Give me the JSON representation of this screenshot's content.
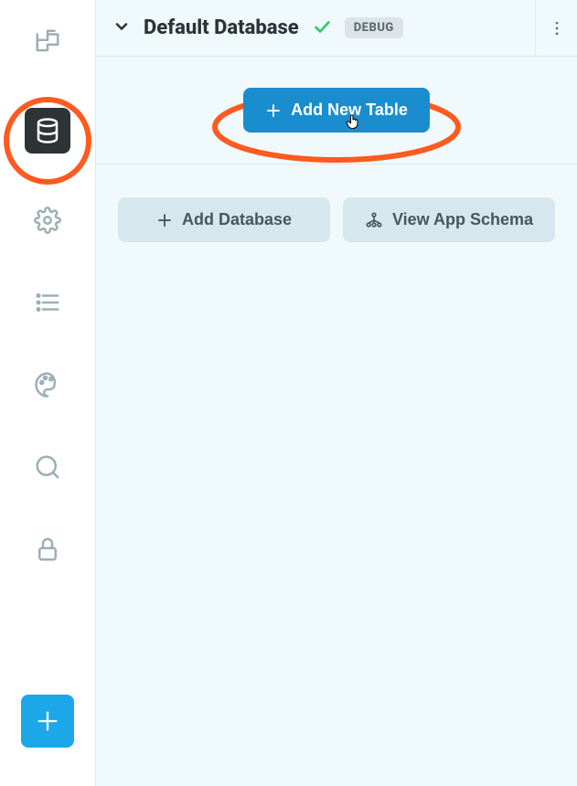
{
  "sidebar": {
    "items": [
      {
        "name": "files-icon"
      },
      {
        "name": "database-icon",
        "active": true
      },
      {
        "name": "settings-icon"
      },
      {
        "name": "list-icon"
      },
      {
        "name": "palette-icon"
      },
      {
        "name": "search-icon"
      },
      {
        "name": "lock-icon"
      }
    ],
    "fab": "add-button"
  },
  "header": {
    "title": "Default Database",
    "status": "ok",
    "badge": "DEBUG"
  },
  "actions": {
    "add_new_table": "Add New Table",
    "add_database": "Add Database",
    "view_app_schema": "View App Schema"
  },
  "annotations": {
    "sidebar_highlight": true,
    "button_highlight": true
  }
}
